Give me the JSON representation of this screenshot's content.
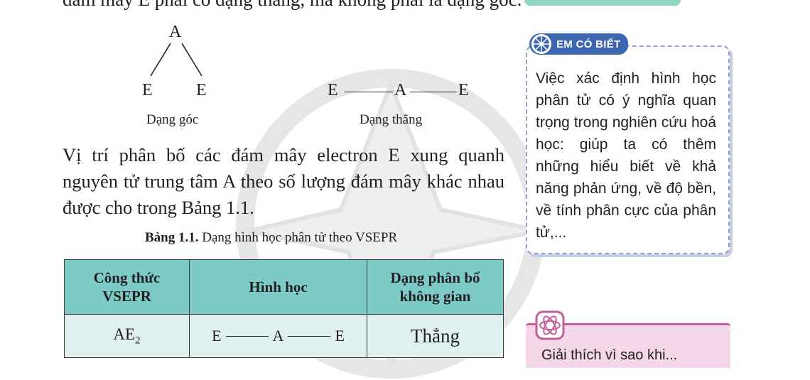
{
  "intro_line": "đám mây E phải có dạng thẳng, mà không phải là dạng góc.",
  "bent_diagram": {
    "center": "A",
    "left": "E",
    "right": "E",
    "caption": "Dạng góc"
  },
  "linear_diagram": {
    "left": "E",
    "center": "A",
    "right": "E",
    "caption": "Dạng thẳng"
  },
  "paragraph": "Vị trí phân bố các đám mây electron E xung quanh nguyên tử trung tâm A theo số lượng đám mây khác nhau được cho trong Bảng 1.1.",
  "table": {
    "caption_label": "Bảng 1.1.",
    "caption_text": " Dạng hình học phân tử theo VSEPR",
    "headers": [
      "Công thức VSEPR",
      "Hình học",
      "Dạng phân bố không gian"
    ],
    "rows": [
      {
        "formula_base": "AE",
        "formula_sub": "2",
        "geometry": [
          "E",
          "A",
          "E"
        ],
        "shape": "Thẳng"
      }
    ]
  },
  "sidebar": {
    "note_title": "EM CÓ BIẾT",
    "note_text": "Việc xác định hình học phân tử có ý nghĩa quan trọng trong nghiên cứu hoá học: giúp ta có thêm những hiểu biết về khả năng phản ứng, về độ bền, về tính phân cực của phân tử,...",
    "partial_text": "Giải thích vì sao khi..."
  },
  "colors": {
    "table_header": "#7ccbc7",
    "table_body": "#dff0ef",
    "note_badge": "#3c67b0",
    "note_border": "#8fa0cf",
    "pink_panel": "#f5d7ea",
    "pink_accent": "#c45c9a"
  }
}
